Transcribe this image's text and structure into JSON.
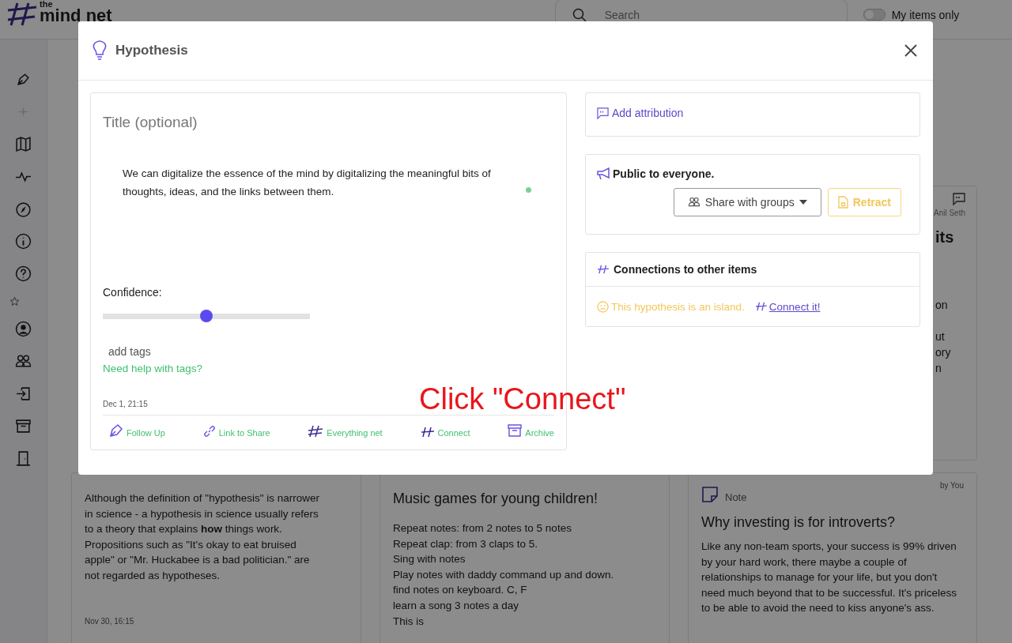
{
  "header": {
    "logo_small": "the",
    "logo": "mind net",
    "search": {
      "placeholder": "Search"
    },
    "my_items_only": {
      "label": "My items only",
      "on": false
    }
  },
  "top_card": {
    "author": "Anil Seth",
    "title_fragment": "its",
    "body_fragments": [
      "on",
      "ut",
      "ory",
      "n"
    ]
  },
  "cards": [
    {
      "kind": "text",
      "body": "Although the definition of \"hypothesis\" is narrower in science - a hypothesis in science usually refers to a theory that explains **how** things work. Propositions such as \"It's okay to eat bruised apple\" or \"Mr. Huckabee is a bad politician.\" are not regarded as hypotheses.",
      "date": "Nov 30, 16:15"
    },
    {
      "kind": "list",
      "title": "Music games for young children!",
      "lines": [
        "Repeat notes: from 2 notes to 5 notes",
        "Repeat clap: from 3 claps to 5.",
        "Sing with notes",
        "Play notes with daddy command up and down.",
        "find notes on keyboard. C, F",
        "learn a song 3 notes a day",
        "This is"
      ]
    },
    {
      "kind": "note",
      "type_label": "Note",
      "byline": "by You",
      "title": "Why investing is for introverts?",
      "body": "Like any non-team sports, your success is 99% driven by your hard work, there maybe a couple of relationships to manage for your life, but you don't need much beyond that to be successful. It's priceless to be able to avoid the need to kiss anyone's ass."
    }
  ],
  "modal": {
    "title": "Hypothesis",
    "title_placeholder": "Title (optional)",
    "body": "We can digitalize the essence of the mind by digitalizing the meaningful bits of thoughts, ideas, and the links between them.",
    "confidence": {
      "label": "Confidence:",
      "level": 0.5
    },
    "tags_placeholder": "add tags",
    "tags_help": "Need help with tags?",
    "date": "Dec 1, 21:15",
    "actions": [
      {
        "kind": "follow_up",
        "label": "Follow Up"
      },
      {
        "kind": "link",
        "label": "Link to Share"
      },
      {
        "kind": "net",
        "label": "Everything net"
      },
      {
        "kind": "connect",
        "label": "Connect"
      },
      {
        "kind": "archive",
        "label": "Archive"
      }
    ],
    "attribution": "Add attribution",
    "visibility": {
      "text": "Public to everyone.",
      "share_button": "Share with groups",
      "retract_button": "Retract"
    },
    "connections": {
      "title": "Connections to other items",
      "empty_message": "This hypothesis is an island.",
      "connect_link": "Connect it!"
    }
  },
  "annotation": "Click \"Connect\""
}
